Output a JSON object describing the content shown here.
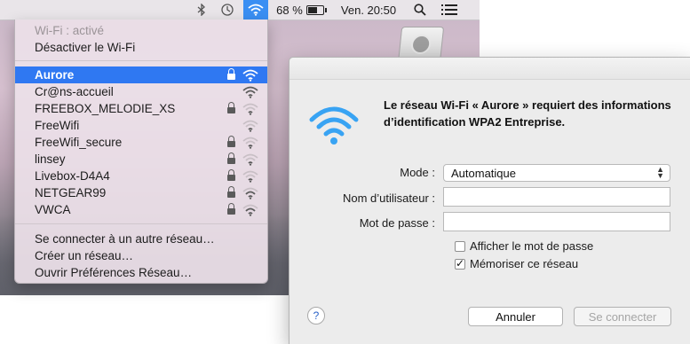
{
  "menubar": {
    "battery_percent": "68 %",
    "clock": "Ven. 20:50",
    "icons": [
      "bluetooth-icon",
      "time-machine-icon",
      "wifi-icon",
      "battery-icon",
      "spotlight-icon",
      "notification-center-icon"
    ]
  },
  "wifi_menu": {
    "status": "Wi-Fi : activé",
    "toggle": "Désactiver le Wi-Fi",
    "networks": [
      {
        "name": "Aurore",
        "locked": true,
        "selected": true,
        "signal": 1.0
      },
      {
        "name": "Cr@ns-accueil",
        "locked": false,
        "selected": false,
        "signal": 0.9
      },
      {
        "name": "FREEBOX_MELODIE_XS",
        "locked": true,
        "selected": false,
        "signal": 0.3
      },
      {
        "name": "FreeWifi",
        "locked": false,
        "selected": false,
        "signal": 0.3
      },
      {
        "name": "FreeWifi_secure",
        "locked": true,
        "selected": false,
        "signal": 0.3
      },
      {
        "name": "linsey",
        "locked": true,
        "selected": false,
        "signal": 0.3
      },
      {
        "name": "Livebox-D4A4",
        "locked": true,
        "selected": false,
        "signal": 0.3
      },
      {
        "name": "NETGEAR99",
        "locked": true,
        "selected": false,
        "signal": 0.6
      },
      {
        "name": "VWCA",
        "locked": true,
        "selected": false,
        "signal": 0.6
      }
    ],
    "actions": [
      "Se connecter à un autre réseau…",
      "Créer un réseau…",
      "Ouvrir Préférences Réseau…"
    ]
  },
  "dialog": {
    "message": "Le réseau Wi-Fi « Aurore » requiert des informations d’identification WPA2 Entreprise.",
    "mode_label": "Mode :",
    "mode_value": "Automatique",
    "username_label": "Nom d’utilisateur :",
    "username_value": "",
    "password_label": "Mot de passe :",
    "password_value": "",
    "show_password_label": "Afficher le mot de passe",
    "show_password_checked": false,
    "remember_label": "Mémoriser ce réseau",
    "remember_checked": true,
    "help_label": "?",
    "cancel_label": "Annuler",
    "connect_label": "Se connecter"
  },
  "colors": {
    "accent": "#2f78f2",
    "wifi_blue": "#3aa0f3"
  }
}
